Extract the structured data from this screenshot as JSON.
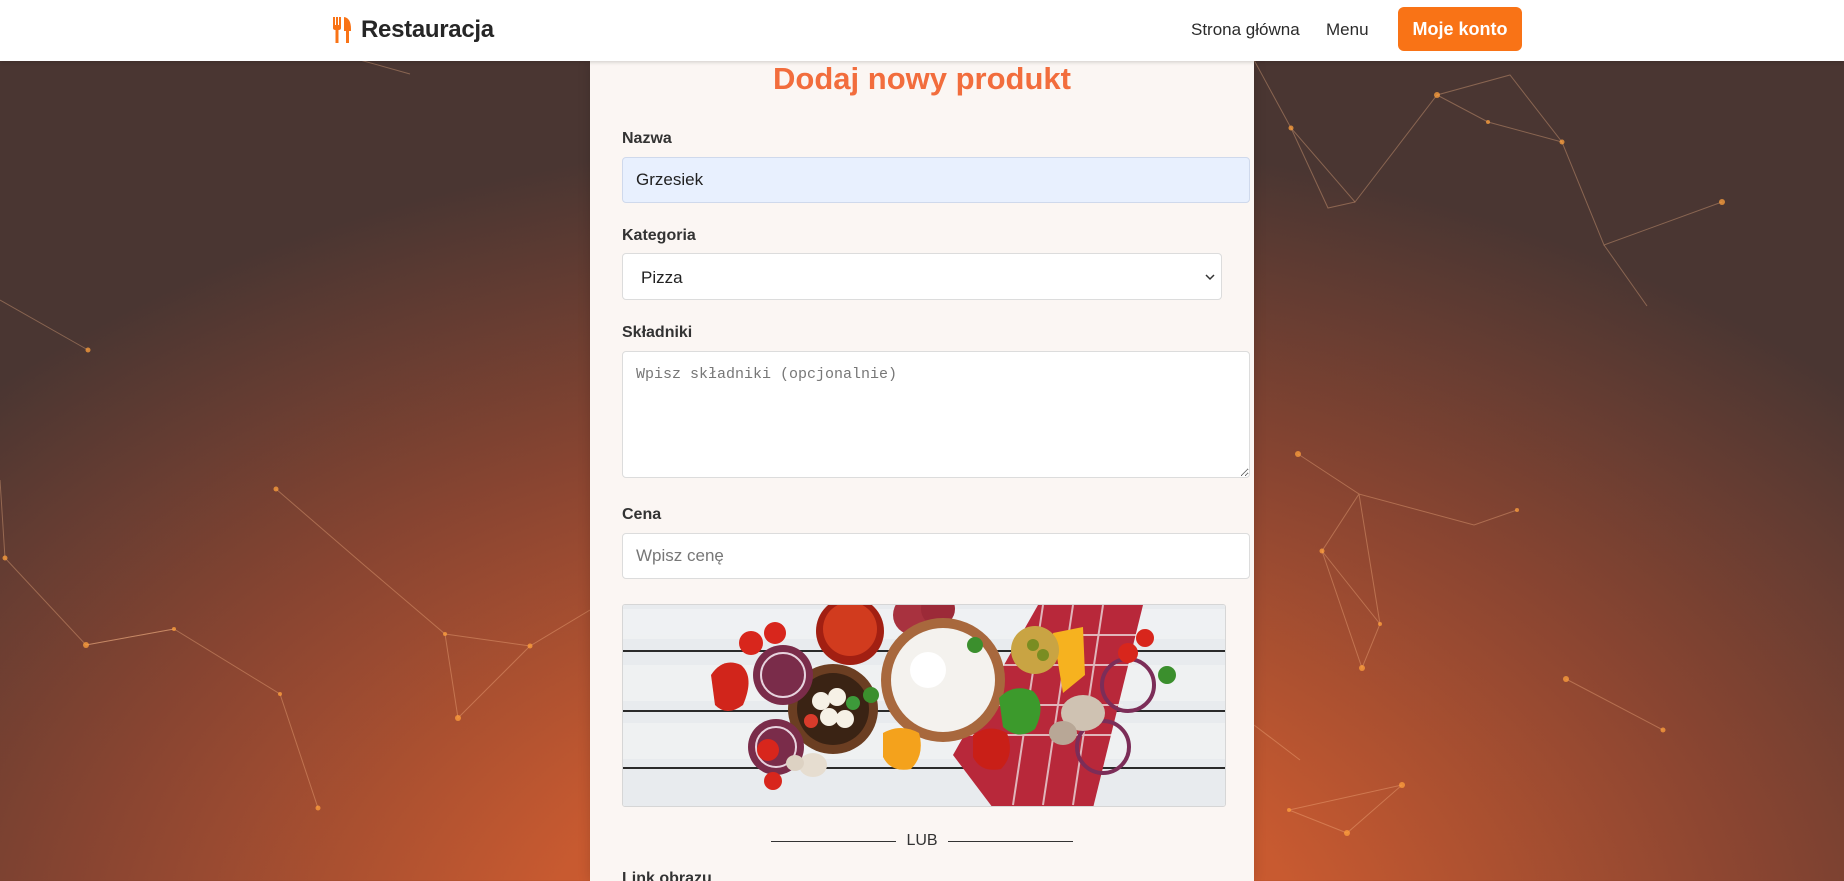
{
  "navbar": {
    "brand": "Restauracja",
    "links": {
      "home": "Strona główna",
      "menu": "Menu"
    },
    "account_button": "Moje konto"
  },
  "form": {
    "title": "Dodaj nowy produkt",
    "name_label": "Nazwa",
    "name_value": "Grzesiek",
    "category_label": "Kategoria",
    "category_value": "Pizza",
    "ingredients_label": "Składniki",
    "ingredients_placeholder": "Wpisz składniki (opcjonalnie)",
    "price_label": "Cena",
    "price_placeholder": "Wpisz cenę",
    "divider_text": "LUB",
    "image_link_label": "Link obrazu"
  },
  "colors": {
    "accent": "#f97316",
    "title": "#f26d3d",
    "card_bg": "#fbf6f3"
  },
  "icons": {
    "brand": "utensils-icon",
    "select": "chevron-down-icon"
  }
}
